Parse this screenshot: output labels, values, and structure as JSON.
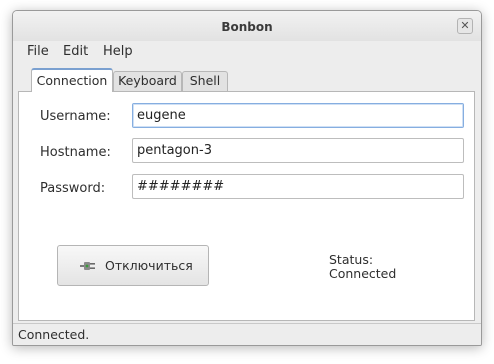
{
  "window": {
    "title": "Bonbon"
  },
  "menu": [
    "File",
    "Edit",
    "Help"
  ],
  "tabs": [
    "Connection",
    "Keyboard",
    "Shell"
  ],
  "active_tab": "Connection",
  "form": {
    "username_label": "Username:",
    "username_value": "eugene",
    "hostname_label": "Hostname:",
    "hostname_value": "pentagon-3",
    "password_label": "Password:",
    "password_value": "########"
  },
  "disconnect_button": {
    "label": "Отключиться",
    "icon": "plug-icon"
  },
  "status": {
    "label": "Status:",
    "value": "Connected"
  },
  "statusbar": {
    "text": "Connected."
  }
}
